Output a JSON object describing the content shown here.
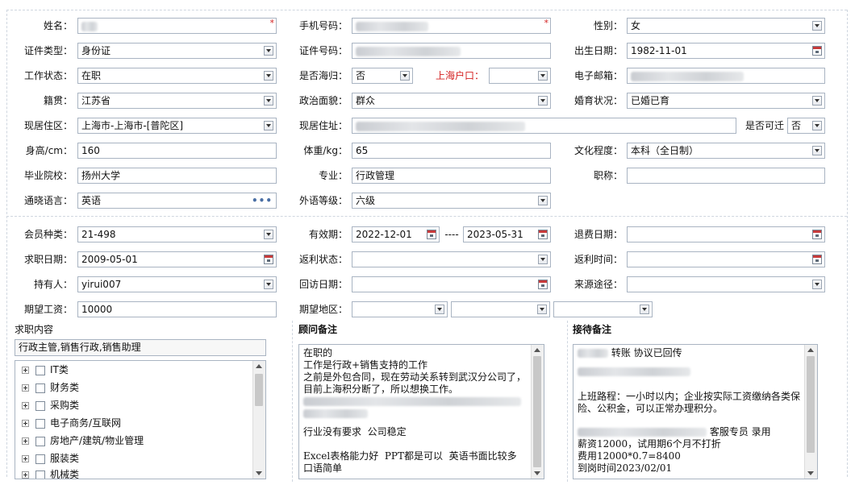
{
  "colors": {
    "border": "#a9b4c2",
    "required": "#d42020",
    "dash": "#cfd6df"
  },
  "personal": {
    "name_label": "姓名：",
    "name_value": "",
    "phone_label": "手机号码：",
    "phone_value": "",
    "gender_label": "性别：",
    "gender_value": "女",
    "idtype_label": "证件类型：",
    "idtype_value": "身份证",
    "idno_label": "证件号码：",
    "idno_value": "",
    "birth_label": "出生日期：",
    "birth_value": "1982-11-01",
    "workstatus_label": "工作状态：",
    "workstatus_value": "在职",
    "returnee_label": "是否海归：",
    "returnee_value": "否",
    "shhukou_label": "上海户口：",
    "shhukou_value": "",
    "email_label": "电子邮箱：",
    "email_value": "",
    "native_label": "籍贯：",
    "native_value": "江苏省",
    "political_label": "政治面貌：",
    "political_value": "群众",
    "marital_label": "婚育状况：",
    "marital_value": "已婚已育",
    "residence_label": "现居住区：",
    "residence_value": "上海市-上海市-[普陀区]",
    "address_label": "现居住址：",
    "address_value": "",
    "relocate_label": "是否可迁",
    "relocate_value": "否",
    "height_label": "身高/cm：",
    "height_value": "160",
    "weight_label": "体重/kg：",
    "weight_value": "65",
    "edu_label": "文化程度：",
    "edu_value": "本科（全日制）",
    "school_label": "毕业院校：",
    "school_value": "扬州大学",
    "major_label": "专业：",
    "major_value": "行政管理",
    "title_label": "职称：",
    "title_value": "",
    "lang_label": "通晓语言：",
    "lang_value": "英语",
    "langlevel_label": "外语等级：",
    "langlevel_value": "六级"
  },
  "member": {
    "type_label": "会员种类：",
    "type_value": "21-498",
    "valid_label": "有效期：",
    "valid_from": "2022-12-01",
    "valid_sep": "----",
    "valid_to": "2023-05-31",
    "refund_label": "退费日期：",
    "refund_value": "",
    "jobdate_label": "求职日期：",
    "jobdate_value": "2009-05-01",
    "rebate_status_label": "返利状态：",
    "rebate_status_value": "",
    "rebate_time_label": "返利时间：",
    "rebate_time_value": "",
    "holder_label": "持有人：",
    "holder_value": "yirui007",
    "visit_label": "回访日期：",
    "visit_value": "",
    "source_label": "来源途径：",
    "source_value": "",
    "salary_label": "期望工资：",
    "salary_value": "10000",
    "area_label": "期望地区：",
    "area_values": [
      "",
      "",
      ""
    ]
  },
  "job": {
    "title": "求职内容",
    "summary": "行政主管,销售行政,销售助理",
    "items": [
      "IT类",
      "财务类",
      "采购类",
      "电子商务/互联网",
      "房地产/建筑/物业管理",
      "服装类",
      "机械类"
    ]
  },
  "advisor": {
    "title": "顾问备注",
    "lines": [
      "在职的",
      "工作是行政+销售支持的工作",
      "之前是外包合同，现在劳动关系转到武汉分公司了，",
      "目前上海积分断了，所以想换工作。",
      "",
      "",
      "行业没有要求  公司稳定",
      "",
      "Excel表格能力好  PPT都是可以  英语书面比较多",
      "口语简单"
    ]
  },
  "reception": {
    "title": "接待备注",
    "lines": [
      "  转账  协议已回传",
      "",
      "",
      "上班路程：一小时以内；企业按实际工资缴纳各类保险、公积金，可以正常办理积分。",
      "",
      "  客服专员  录用",
      "薪资12000，试用期6个月不打折",
      "费用12000*0.7=8400",
      "到岗时间2023/02/01"
    ]
  }
}
